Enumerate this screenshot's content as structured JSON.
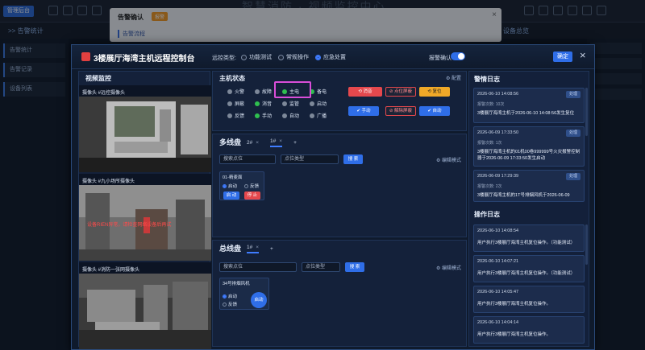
{
  "bg": {
    "brand": "管理后台",
    "title": "智慧消防 · 视频监控中心",
    "sub_left": ">> 告警统计",
    "sub_right": "设备总览",
    "left_rows": [
      "告警统计",
      "告警记录",
      "设备列表"
    ],
    "alarm_dialog": {
      "title": "告警确认",
      "tag": "报警",
      "section": "告警流程",
      "close": "×"
    }
  },
  "modal": {
    "title": "3楼展厅海湾主机远程控制台",
    "type_label": "远控类型:",
    "types": [
      "功能测试",
      "常规操作",
      "应急处置"
    ],
    "selected_type_index": 2,
    "confirm_label": "报警确认",
    "confirm_on": true,
    "ok_label": "确定",
    "close": "×"
  },
  "video": {
    "title": "视频监控",
    "cams": [
      {
        "label": "摄像头 #远控摄像头"
      },
      {
        "label": "摄像头 #九小场所摄像头",
        "overlay": "设备RIEN异常，请检查网络设备后再试"
      },
      {
        "label": "摄像头 #消防一张网摄像头"
      }
    ]
  },
  "status": {
    "title": "主机状态",
    "config": "⚙ 配置",
    "items": [
      {
        "label": "火警",
        "on": false
      },
      {
        "label": "故障",
        "on": false
      },
      {
        "label": "主电",
        "on": true
      },
      {
        "label": "备电",
        "on": true
      },
      {
        "label": "屏蔽",
        "on": false
      },
      {
        "label": "消音",
        "on": true
      },
      {
        "label": "监管",
        "on": false
      },
      {
        "label": "启动",
        "on": false
      },
      {
        "label": "反馈",
        "on": false
      },
      {
        "label": "手动",
        "on": true
      },
      {
        "label": "自动",
        "on": false
      },
      {
        "label": "广播",
        "on": false
      }
    ],
    "buttons": {
      "reset": "⟲ 消音",
      "point_shield": "⊘ 点位屏蔽",
      "resetb": "⟲ 复位",
      "manual": "✔ 手动",
      "unshield": "⊘ 解除屏蔽",
      "auto": "✔ 自动"
    }
  },
  "loop": {
    "title": "多线盘",
    "tabs": [
      "2#",
      "1#"
    ],
    "tab_close": "×",
    "add": "+",
    "search_placeholder": "搜索点位",
    "type_placeholder": "点位类型",
    "search_btn": "搜 索",
    "edit_mode": "⚙ 编辑模式",
    "card": {
      "name": "01-精麦面",
      "r1": "启动",
      "r2": "反馈",
      "start": "启 动",
      "stop": "停 止"
    }
  },
  "bus": {
    "title": "总线盘",
    "tabs": [
      "1#"
    ],
    "tab_close": "×",
    "add": "+",
    "search_placeholder": "搜索点位",
    "type_placeholder": "点位类型",
    "search_btn": "搜 索",
    "edit_mode": "⚙ 编辑模式",
    "card": {
      "name": "34号排烟风机",
      "r1": "启动",
      "r2": "反馈",
      "start": "启动"
    }
  },
  "alarm_log": {
    "title": "警情日志",
    "items": [
      {
        "time": "2026-06-10 14:08:56",
        "count": "报警次数: 10次",
        "msg": "3楼展厅海湾主机于2026-06-10 14:08:56发生复位",
        "op": "处理"
      },
      {
        "time": "2026-06-09 17:33:50",
        "count": "报警次数: 1次",
        "msg": "3楼展厅海湾主机的01机00卷999999号火灾报警控制器于2026-06-09 17:33:50发生启动",
        "op": "处理"
      },
      {
        "time": "2026-06-09 17:29:39",
        "count": "报警次数: 2次",
        "msg": "3楼展厅海湾主机的1T号排烟风机于2026-06-09",
        "op": "处理"
      }
    ]
  },
  "op_log": {
    "title": "操作日志",
    "items": [
      {
        "time": "2026-06-10 14:08:54",
        "msg": "用户执行3楼展厅海湾主机复位操作。（功能测试）"
      },
      {
        "time": "2026-06-10 14:07:21",
        "msg": "用户执行3楼展厅海湾主机复位操作。（功能测试）"
      },
      {
        "time": "2026-06-10 14:05:47",
        "msg": "用户执行3楼展厅海湾主机复位操作。"
      },
      {
        "time": "2026-06-10 14:04:14",
        "msg": "用户执行3楼展厅海湾主机复位操作。"
      }
    ]
  }
}
